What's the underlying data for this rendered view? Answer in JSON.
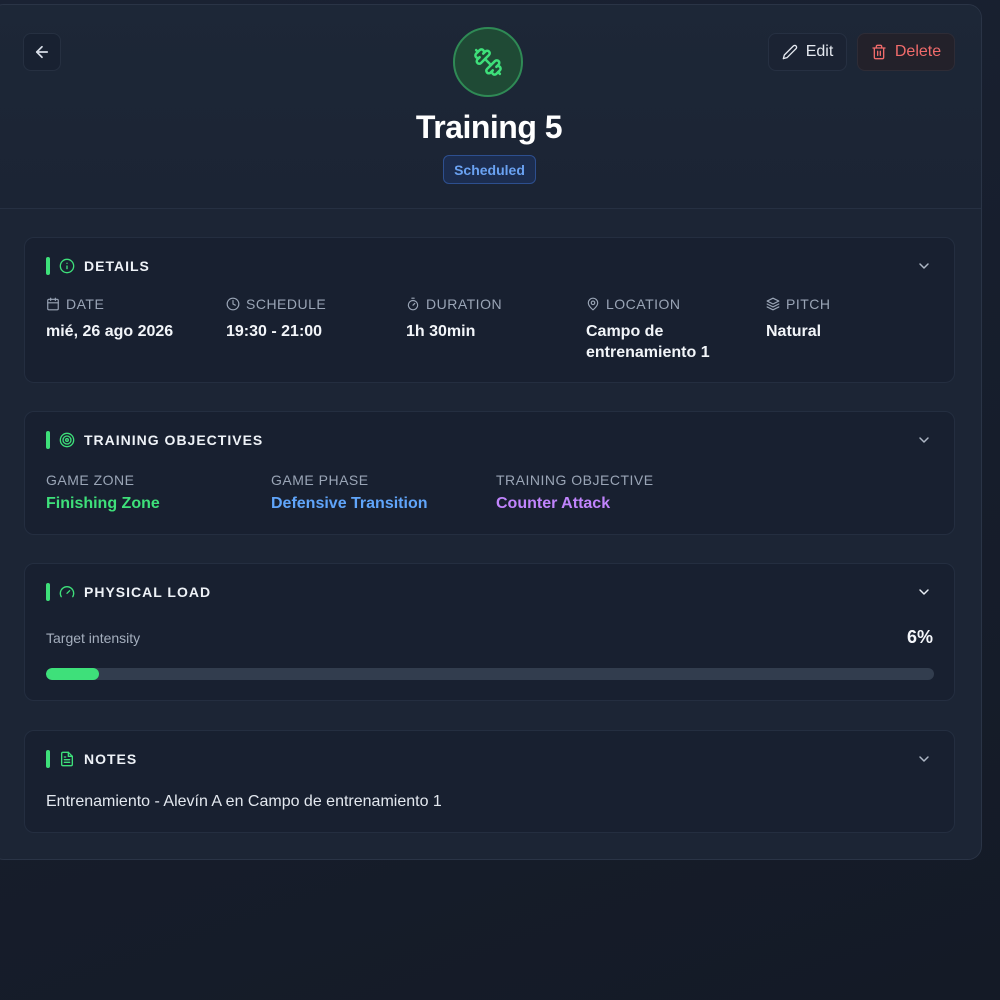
{
  "header": {
    "title": "Training 5",
    "status": "Scheduled",
    "edit_label": "Edit",
    "delete_label": "Delete",
    "hero_icon": "dumbbell-icon",
    "back_icon": "arrow-left-icon"
  },
  "details": {
    "title": "DETAILS",
    "items": [
      {
        "label": "DATE",
        "value": "mié, 26 ago 2026",
        "icon": "calendar-icon"
      },
      {
        "label": "SCHEDULE",
        "value": "19:30 - 21:00",
        "icon": "clock-icon"
      },
      {
        "label": "DURATION",
        "value": "1h 30min",
        "icon": "stopwatch-icon"
      },
      {
        "label": "LOCATION",
        "value": "Campo de entrenamiento 1",
        "icon": "map-pin-icon"
      },
      {
        "label": "PITCH",
        "value": "Natural",
        "icon": "layers-icon"
      }
    ]
  },
  "objectives": {
    "title": "TRAINING OBJECTIVES",
    "items": [
      {
        "label": "GAME ZONE",
        "value": "Finishing Zone",
        "color": "#3ee07a"
      },
      {
        "label": "GAME PHASE",
        "value": "Defensive Transition",
        "color": "#60a5fa"
      },
      {
        "label": "TRAINING OBJECTIVE",
        "value": "Counter Attack",
        "color": "#c084fc"
      }
    ]
  },
  "physical_load": {
    "title": "PHYSICAL LOAD",
    "label": "Target intensity",
    "value_text": "6%",
    "value": 6
  },
  "notes": {
    "title": "NOTES",
    "text": "Entrenamiento - Alevín A en Campo de entrenamiento 1"
  },
  "colors": {
    "accent": "#3ee07a",
    "danger": "#f06b6b",
    "badge": "#6aa2f2"
  }
}
